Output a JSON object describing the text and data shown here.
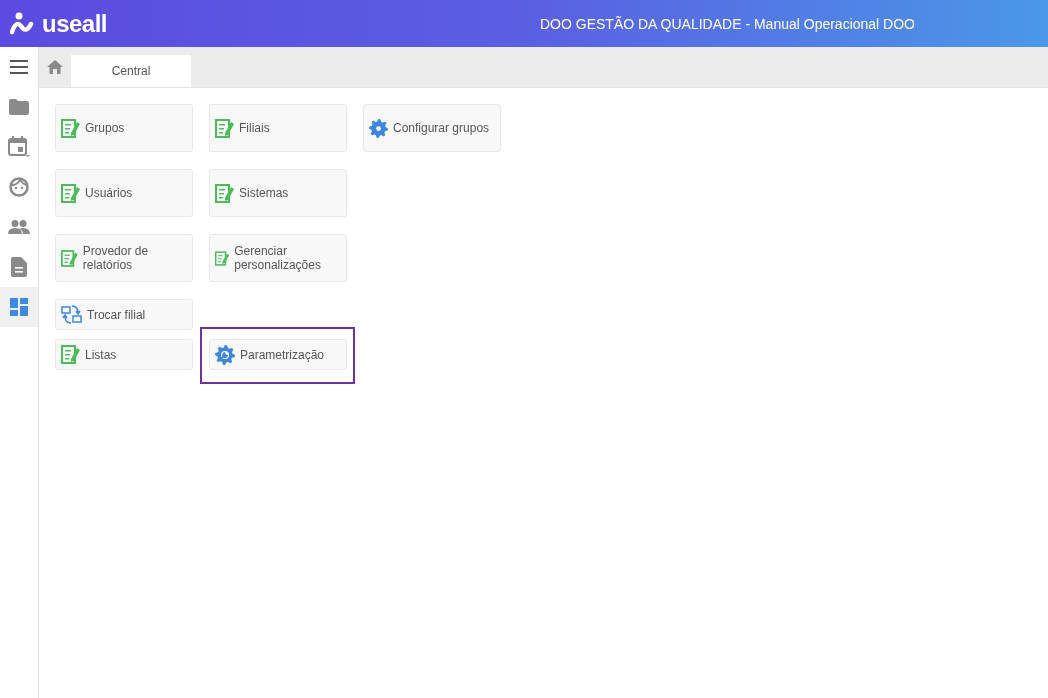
{
  "header": {
    "logo": "useall",
    "title": "DOO GESTÃO DA QUALIDADE - Manual Operacional DOO"
  },
  "sidebar": {
    "items": [
      {
        "kind": "menu",
        "selected": false
      },
      {
        "kind": "folder",
        "selected": false
      },
      {
        "kind": "calendar",
        "selected": false
      },
      {
        "kind": "face",
        "selected": false
      },
      {
        "kind": "people",
        "selected": false
      },
      {
        "kind": "document",
        "selected": false
      },
      {
        "kind": "dashboard",
        "selected": true
      }
    ]
  },
  "tabs": [
    {
      "label": "Central",
      "selected": true
    }
  ],
  "tile_rows": [
    {
      "tiles": [
        {
          "label": "Grupos",
          "kind": "form",
          "highlighted": false
        },
        {
          "label": "Filiais",
          "kind": "form",
          "highlighted": false
        },
        {
          "label": "Configurar grupos",
          "kind": "gear",
          "highlighted": false
        }
      ]
    },
    {
      "tiles": [
        {
          "label": "Usuários",
          "kind": "form",
          "highlighted": false
        },
        {
          "label": "Sistemas",
          "kind": "form",
          "highlighted": false
        }
      ]
    },
    {
      "tiles": [
        {
          "label": "Provedor de relatórios",
          "kind": "form",
          "highlighted": false
        },
        {
          "label": "Gerenciar personalizações",
          "kind": "form",
          "highlighted": false
        }
      ]
    },
    {
      "tiles": [
        {
          "label": "Trocar filial",
          "kind": "swap",
          "highlighted": false
        }
      ]
    },
    {
      "tiles": [
        {
          "label": "Listas",
          "kind": "form",
          "highlighted": false
        },
        {
          "label": "Parametrização",
          "kind": "wrench-gear",
          "highlighted": true
        }
      ]
    }
  ]
}
